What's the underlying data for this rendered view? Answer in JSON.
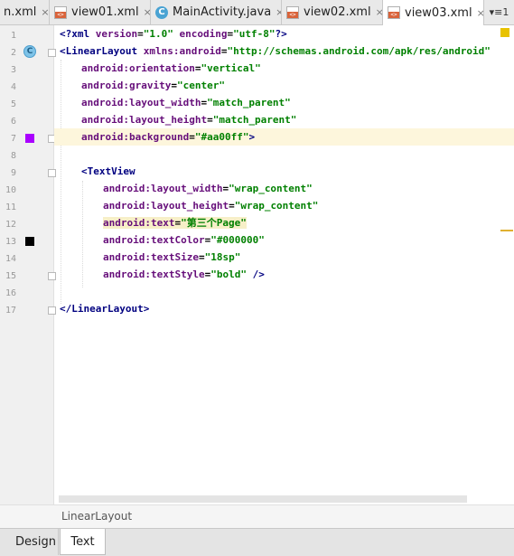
{
  "tabs": [
    {
      "label": "n.xml",
      "icon": "xml-file-icon",
      "close": "×",
      "active": false
    },
    {
      "label": "view01.xml",
      "icon": "xml-file-icon",
      "close": "×",
      "active": false
    },
    {
      "label": "MainActivity.java",
      "icon": "java-class-icon",
      "icon_glyph": "C",
      "close": "×",
      "active": false
    },
    {
      "label": "view02.xml",
      "icon": "xml-file-icon",
      "close": "×",
      "active": false
    },
    {
      "label": "view03.xml",
      "icon": "xml-file-icon",
      "close": "×",
      "active": true
    }
  ],
  "tabs_overflow": "▾≡1",
  "gutter": {
    "line_numbers": [
      "1",
      "2",
      "3",
      "4",
      "5",
      "6",
      "7",
      "8",
      "9",
      "10",
      "11",
      "12",
      "13",
      "14",
      "15",
      "16",
      "17"
    ],
    "class_marker_glyph": "C",
    "color_swatches": {
      "line7": "#aa00ff",
      "line13": "#000000"
    }
  },
  "code": {
    "l1": {
      "pi_open": "<?",
      "tag": "xml",
      "sp1": " ",
      "a1": "version",
      "eq1": "=",
      "v1": "\"1.0\"",
      "sp2": " ",
      "a2": "encoding",
      "eq2": "=",
      "v2": "\"utf-8\"",
      "pi_close": "?>"
    },
    "l2": {
      "lt": "<",
      "tag": "LinearLayout",
      "sp": " ",
      "attr": "xmlns:android",
      "eq": "=",
      "val": "\"http://schemas.android.com/apk/res/android\""
    },
    "l3": {
      "attr": "android:orientation",
      "eq": "=",
      "val": "\"vertical\""
    },
    "l4": {
      "attr": "android:gravity",
      "eq": "=",
      "val": "\"center\""
    },
    "l5": {
      "attr": "android:layout_width",
      "eq": "=",
      "val": "\"match_parent\""
    },
    "l6": {
      "attr": "android:layout_height",
      "eq": "=",
      "val": "\"match_parent\""
    },
    "l7": {
      "attr": "android:background",
      "eq": "=",
      "val": "\"#aa00ff\"",
      "gt": ">"
    },
    "l9": {
      "lt": "<",
      "tag": "TextView"
    },
    "l10": {
      "attr": "android:layout_width",
      "eq": "=",
      "val": "\"wrap_content\""
    },
    "l11": {
      "attr": "android:layout_height",
      "eq": "=",
      "val": "\"wrap_content\""
    },
    "l12": {
      "attr": "android:text",
      "eq": "=",
      "val": "\"第三个Page\""
    },
    "l13": {
      "attr": "android:textColor",
      "eq": "=",
      "val": "\"#000000\""
    },
    "l14": {
      "attr": "android:textSize",
      "eq": "=",
      "val": "\"18sp\""
    },
    "l15": {
      "attr": "android:textStyle",
      "eq": "=",
      "val": "\"bold\"",
      "end": " />"
    },
    "l17": {
      "open": "</",
      "tag": "LinearLayout",
      "close": ">"
    }
  },
  "breadcrumb": "LinearLayout",
  "bottom_tabs": [
    {
      "label": "Design",
      "active": false
    },
    {
      "label": "Text",
      "active": true
    }
  ],
  "colors": {
    "tag": "#000080",
    "attr": "#660e7a",
    "value": "#008000",
    "current_line": "#fdf6dc"
  }
}
